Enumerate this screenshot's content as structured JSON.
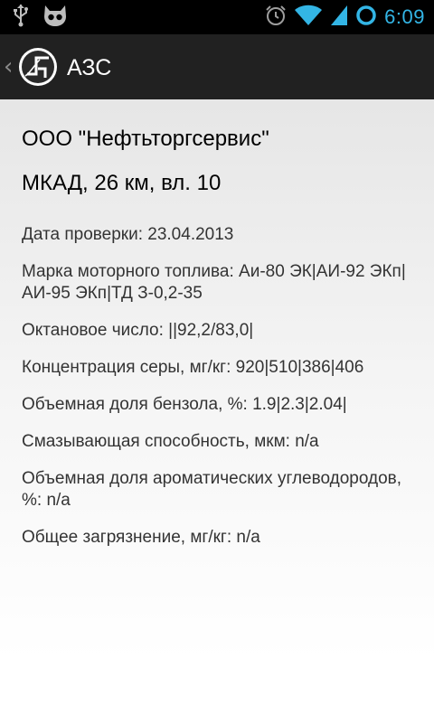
{
  "status_bar": {
    "left_icons": [
      "usb-icon",
      "android-debug-icon"
    ],
    "right_icons": [
      "alarm-icon",
      "wifi-icon",
      "signal-icon",
      "battery-icon"
    ],
    "time": "6:09",
    "accent_color": "#33b5e5"
  },
  "action_bar": {
    "title": "АЗС",
    "up_icon": "chevron-left-icon",
    "logo_icon": "app-logo-icon"
  },
  "station": {
    "name": "ООО \"Нефтьторгсервис\"",
    "address": "МКАД, 26 км, вл. 10"
  },
  "details": [
    "Дата проверки: 23.04.2013",
    "Марка моторного топлива: Аи-80 ЭК|АИ-92 ЭКп|АИ-95 ЭКп|ТД З-0,2-35",
    "Октановое число: ||92,2/83,0|",
    "Концентрация серы, мг/кг: 920|510|386|406",
    "Объемная доля бензола, %: 1.9|2.3|2.04|",
    "Смазывающая способность, мкм: n/a",
    "Объемная доля ароматических углеводородов, %: n/a",
    "Общее загрязнение, мг/кг: n/a"
  ]
}
